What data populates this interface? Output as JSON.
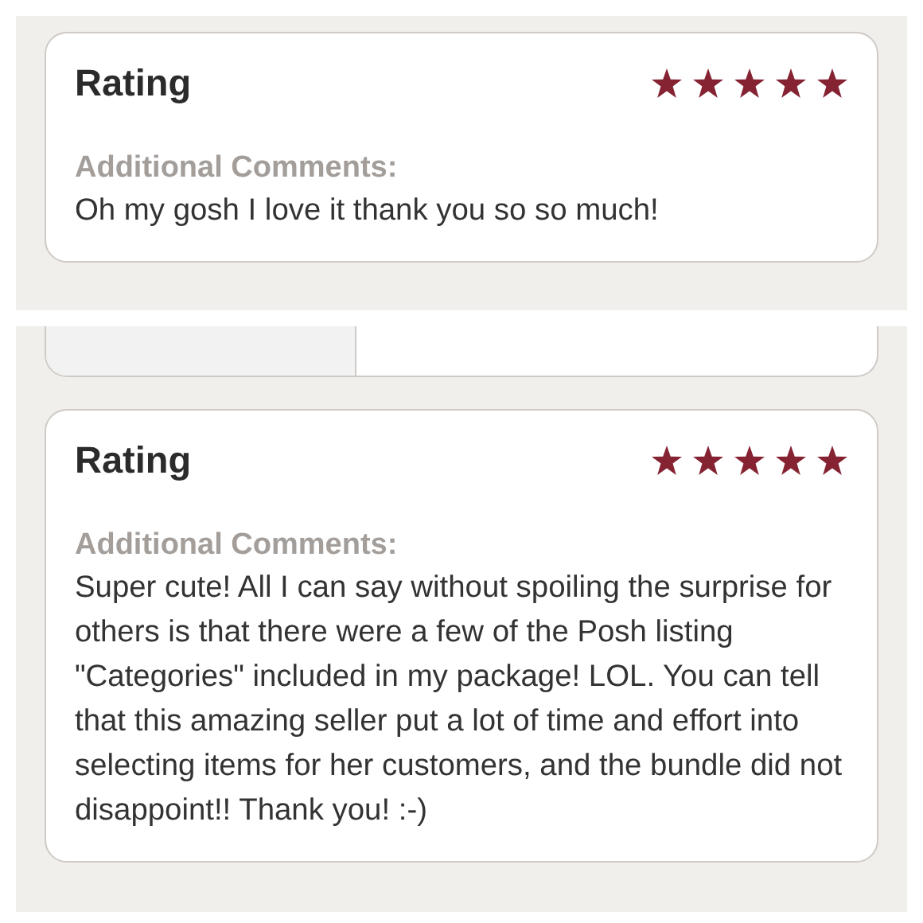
{
  "sections": [
    {
      "kind": "review",
      "title": "Rating",
      "stars": 5,
      "label": "Additional Comments:",
      "comment": "Oh my gosh I love it thank you so so much!"
    },
    {
      "kind": "table_fragment"
    },
    {
      "kind": "review",
      "title": "Rating",
      "stars": 5,
      "label": "Additional Comments:",
      "comment": "Super cute! All I can say without spoiling the surprise for others is that there were a few of the Posh listing \"Categories\" included in my package! LOL. You can tell that this amazing seller put a lot of time and effort into selecting items for her customers, and the bundle did not disappoint!! Thank you! :-)"
    }
  ]
}
